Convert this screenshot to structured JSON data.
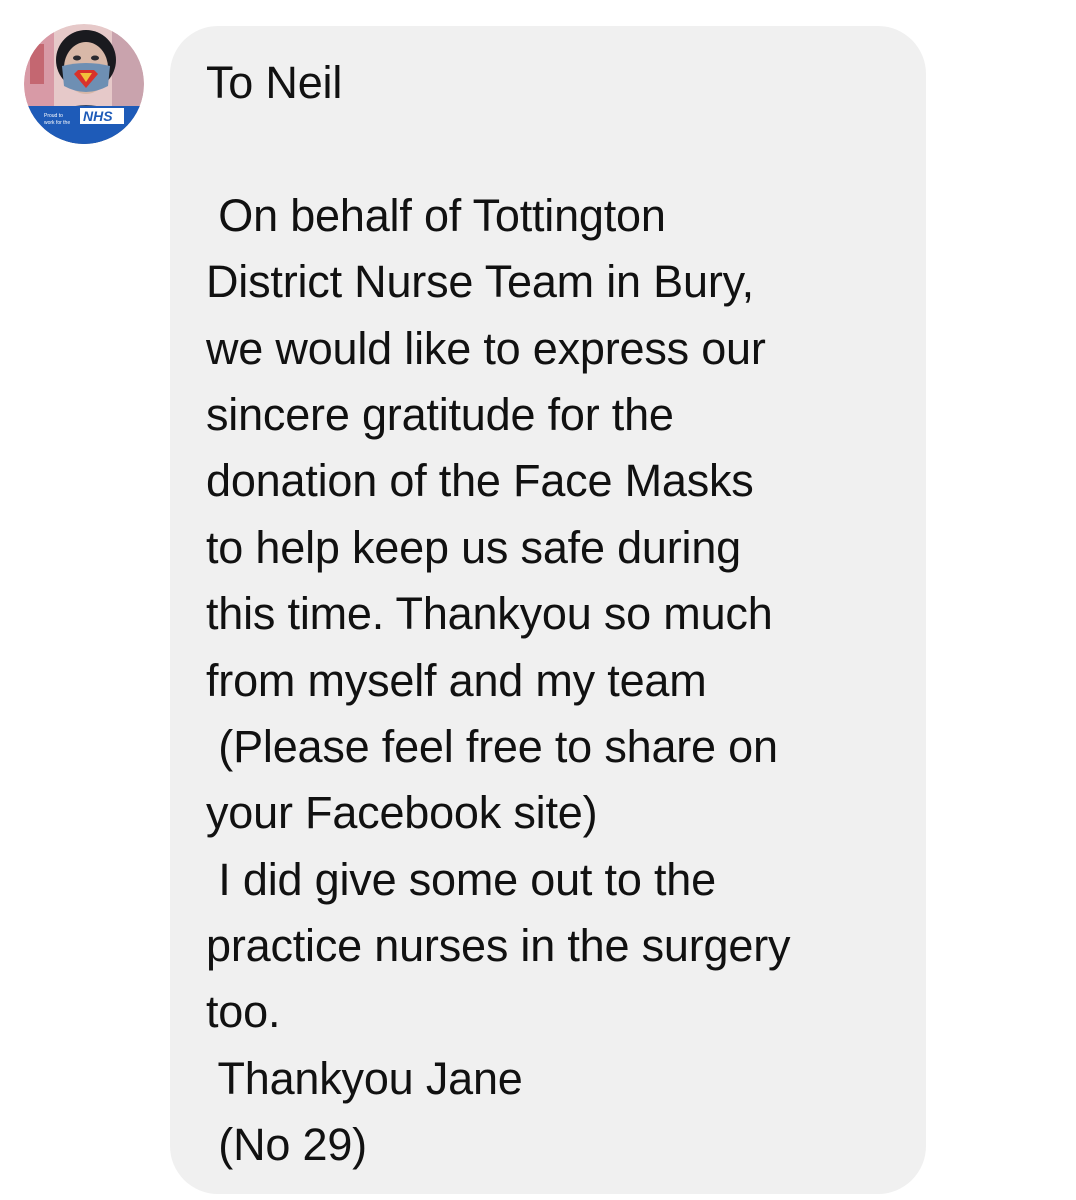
{
  "conversation": {
    "sender_avatar": {
      "badge_text": "NHS",
      "caption_line_1": "Proud to",
      "caption_line_2": "work for the",
      "icon": "avatar-photo-nhs-badge",
      "badge_color": "#1e5bb8"
    },
    "message": {
      "bubble_color": "#f0f0f0",
      "text_color": "#111111",
      "lines": [
        "To Neil",
        "",
        " On behalf of Tottington",
        "District Nurse Team in Bury,",
        "we would like to express our",
        "sincere gratitude for the",
        "donation of the Face Masks",
        "to help keep us safe during",
        "this time. Thankyou so much",
        "from myself and my team",
        " (Please feel free to share on",
        "your Facebook site)",
        " I did give some out to the",
        "practice nurses in the surgery",
        "too.",
        " Thankyou Jane",
        " (No 29)"
      ]
    }
  }
}
